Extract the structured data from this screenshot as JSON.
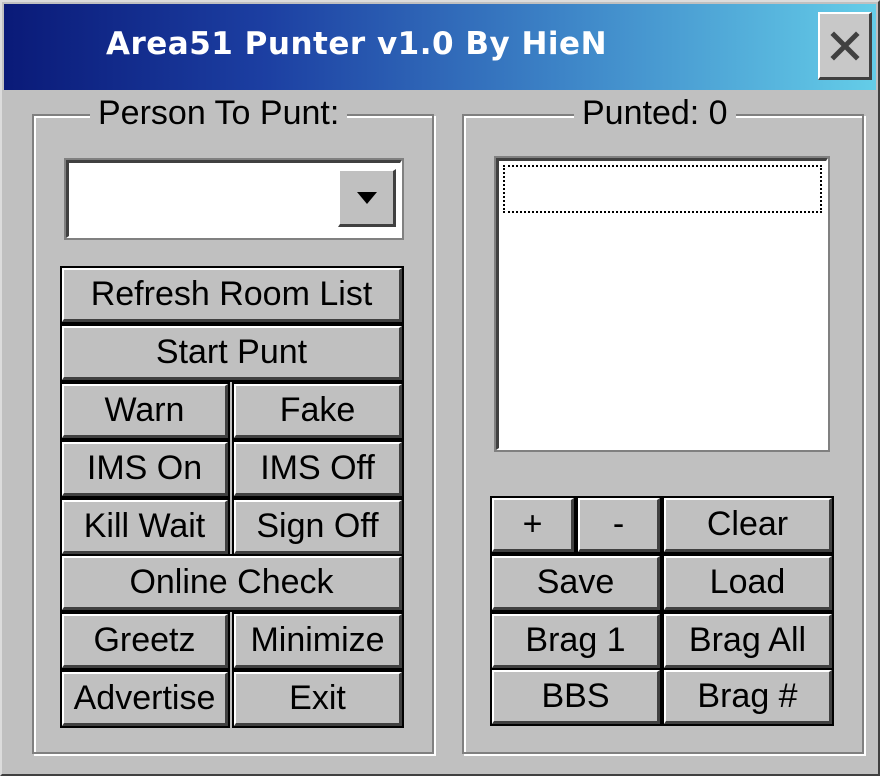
{
  "window": {
    "title": "Area51 Punter v1.0 By HieN",
    "close_glyph": "✕"
  },
  "person_group": {
    "legend": "Person To Punt:",
    "combo_value": "",
    "dropdown_glyph": "▼"
  },
  "punted_group": {
    "legend": "Punted: 0",
    "list_items": []
  },
  "left_buttons": {
    "refresh_room_list": "Refresh Room List",
    "start_punt": "Start Punt",
    "warn": "Warn",
    "fake": "Fake",
    "ims_on": "IMS On",
    "ims_off": "IMS Off",
    "kill_wait": "Kill Wait",
    "sign_off": "Sign Off",
    "online_check": "Online Check",
    "greetz": "Greetz",
    "minimize": "Minimize",
    "advertise": "Advertise",
    "exit": "Exit"
  },
  "right_buttons": {
    "plus": "+",
    "minus": "-",
    "clear": "Clear",
    "save": "Save",
    "load": "Load",
    "brag_1": "Brag 1",
    "brag_all": "Brag All",
    "bbs": "BBS",
    "brag_num": "Brag #"
  },
  "colors": {
    "face": "#c0c0c0",
    "title_start": "#0a1a78",
    "title_end": "#64cde8"
  }
}
